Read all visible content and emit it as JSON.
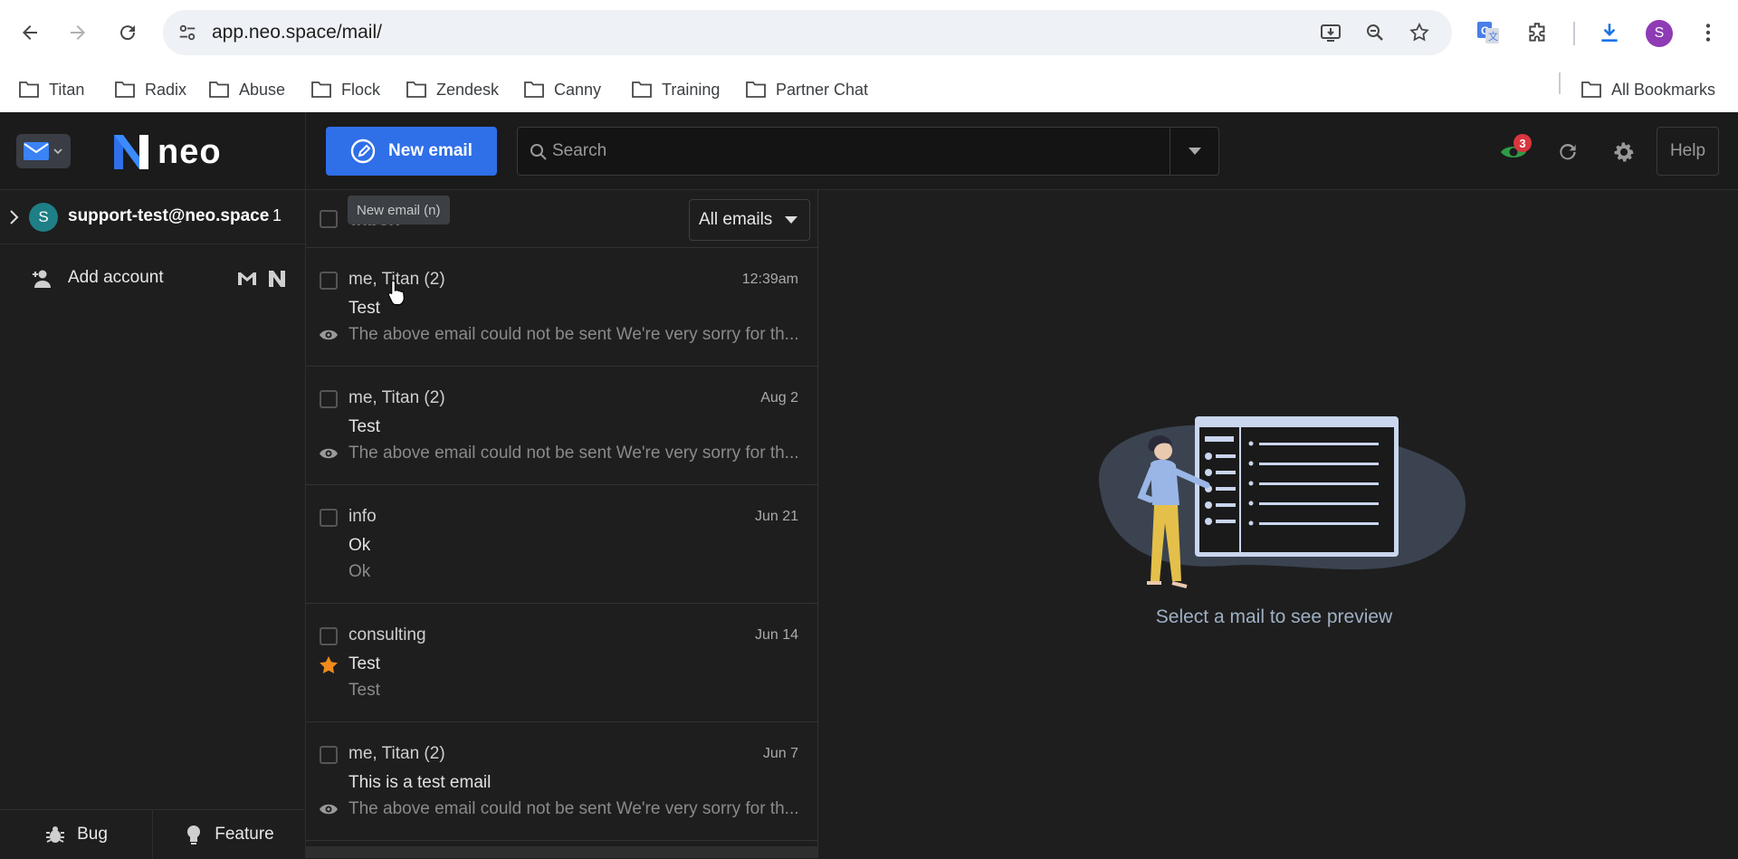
{
  "browser": {
    "url": "app.neo.space/mail/",
    "profile_initial": "S",
    "bookmarks": [
      "Titan",
      "Radix",
      "Abuse",
      "Flock",
      "Zendesk",
      "Canny",
      "Training",
      "Partner Chat"
    ],
    "all_bookmarks": "All Bookmarks"
  },
  "app": {
    "logo_text": "neo",
    "new_email_label": "New email",
    "new_email_tooltip": "New email (n)",
    "search_placeholder": "Search",
    "notification_count": "3",
    "help_label": "Help",
    "accent_color": "#2f6fe8"
  },
  "sidebar": {
    "account_initial": "S",
    "account_email": "support-test@neo.space",
    "account_unread": "1",
    "add_account_label": "Add account",
    "bug_label": "Bug",
    "feature_label": "Feature"
  },
  "list": {
    "title": "Inbox",
    "filter": "All emails",
    "emails": [
      {
        "from": "me, Titan (2)",
        "date": "12:39am",
        "subject": "Test",
        "preview": "The above email could not be sent We're very sorry for th...",
        "icon": "eye-icon"
      },
      {
        "from": "me, Titan (2)",
        "date": "Aug 2",
        "subject": "Test",
        "preview": "The above email could not be sent We're very sorry for th...",
        "icon": "eye-icon"
      },
      {
        "from": "info",
        "date": "Jun 21",
        "subject": "Ok",
        "preview": "Ok",
        "icon": ""
      },
      {
        "from": "consulting",
        "date": "Jun 14",
        "subject": "Test",
        "preview": "Test",
        "icon": "star-icon"
      },
      {
        "from": "me, Titan (2)",
        "date": "Jun 7",
        "subject": "This is a test email",
        "preview": "The above email could not be sent We're very sorry for th...",
        "icon": "eye-icon"
      }
    ]
  },
  "preview": {
    "empty_text": "Select a mail to see preview"
  }
}
